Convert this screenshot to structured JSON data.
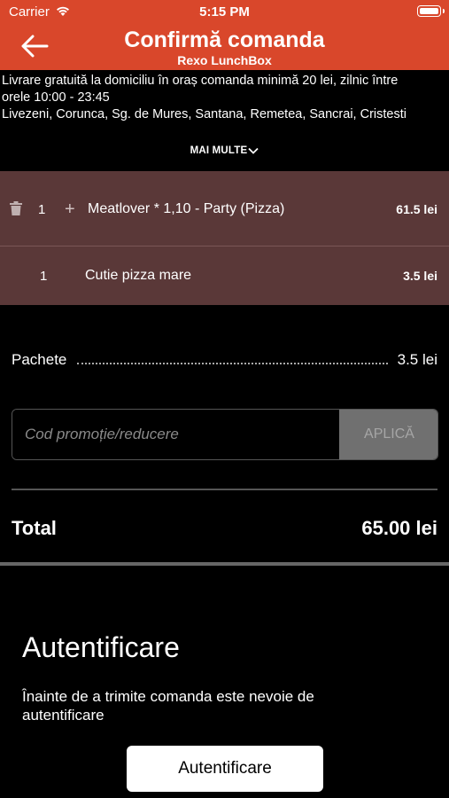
{
  "status_bar": {
    "carrier": "Carrier",
    "time": "5:15 PM"
  },
  "header": {
    "title": "Confirmă comanda",
    "subtitle": "Rexo LunchBox"
  },
  "delivery_info": {
    "line1": "Livrare gratuită la domiciliu în oraș comanda minimă 20 lei, zilnic între",
    "line2": "orele 10:00 - 23:45",
    "line3": "Livezeni, Corunca, Sg. de Mures, Santana, Remetea, Sancrai, Cristesti",
    "more_label": "MAI MULTE"
  },
  "cart": {
    "items": [
      {
        "qty": "1",
        "name": "Meatlover * 1,10 - Party (Pizza)",
        "price": "61.5 lei"
      },
      {
        "qty": "1",
        "name": "Cutie pizza mare",
        "price": "3.5 lei"
      }
    ]
  },
  "summary": {
    "packages_label": "Pachete",
    "packages_value": "3.5 lei",
    "promo_placeholder": "Cod promoție/reducere",
    "apply_label": "APLICĂ",
    "total_label": "Total",
    "total_value": "65.00 lei"
  },
  "auth": {
    "title": "Autentificare",
    "text": "Înainte de a trimite comanda este nevoie de autentificare",
    "button_label": "Autentificare"
  },
  "colors": {
    "accent": "#d9472b",
    "cart_bg": "#5a3838",
    "background": "#000000"
  }
}
